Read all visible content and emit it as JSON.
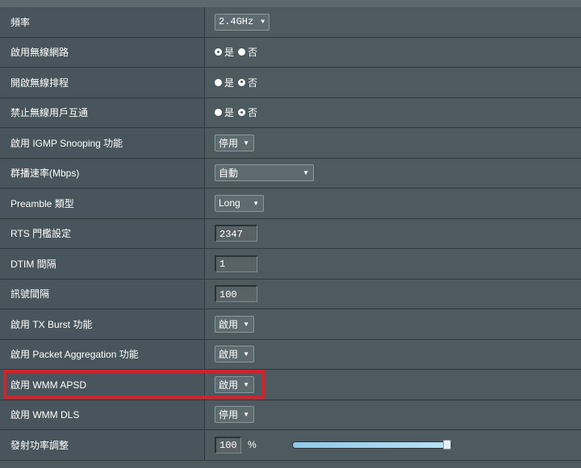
{
  "rows": [
    {
      "label": "頻率",
      "type": "select",
      "value": "2.4GHz"
    },
    {
      "label": "啟用無線網路",
      "type": "radio",
      "options": [
        "是",
        "否"
      ],
      "selected": 0
    },
    {
      "label": "開啟無線排程",
      "type": "radio",
      "options": [
        "是",
        "否"
      ],
      "selected": 1
    },
    {
      "label": "禁止無線用戶互通",
      "type": "radio",
      "options": [
        "是",
        "否"
      ],
      "selected": 1
    },
    {
      "label": "啟用 IGMP Snooping 功能",
      "type": "select",
      "value": "停用"
    },
    {
      "label": "群播速率(Mbps)",
      "type": "select",
      "value": "自動"
    },
    {
      "label": "Preamble 類型",
      "type": "select",
      "value": "Long"
    },
    {
      "label": "RTS 門檻設定",
      "type": "input",
      "value": "2347"
    },
    {
      "label": "DTIM 間隔",
      "type": "input",
      "value": "1"
    },
    {
      "label": "訊號間隔",
      "type": "input",
      "value": "100"
    },
    {
      "label": "啟用 TX Burst 功能",
      "type": "select",
      "value": "啟用"
    },
    {
      "label": "啟用 Packet Aggregation 功能",
      "type": "select",
      "value": "啟用"
    },
    {
      "label": "啟用 WMM APSD",
      "type": "select",
      "value": "啟用"
    },
    {
      "label": "啟用 WMM DLS",
      "type": "select",
      "value": "停用"
    },
    {
      "label": "發射功率調整",
      "type": "input-slider",
      "value": "100",
      "unit": "%",
      "slider_level": 1.0
    }
  ],
  "highlight": {
    "row_label": "啟用 WMM APSD",
    "color": "#d0242c"
  },
  "colors": {
    "background": "#4d5a60",
    "label_background": "#48555c",
    "border": "#2f393e",
    "slider_fill": "#8fc9e9"
  }
}
